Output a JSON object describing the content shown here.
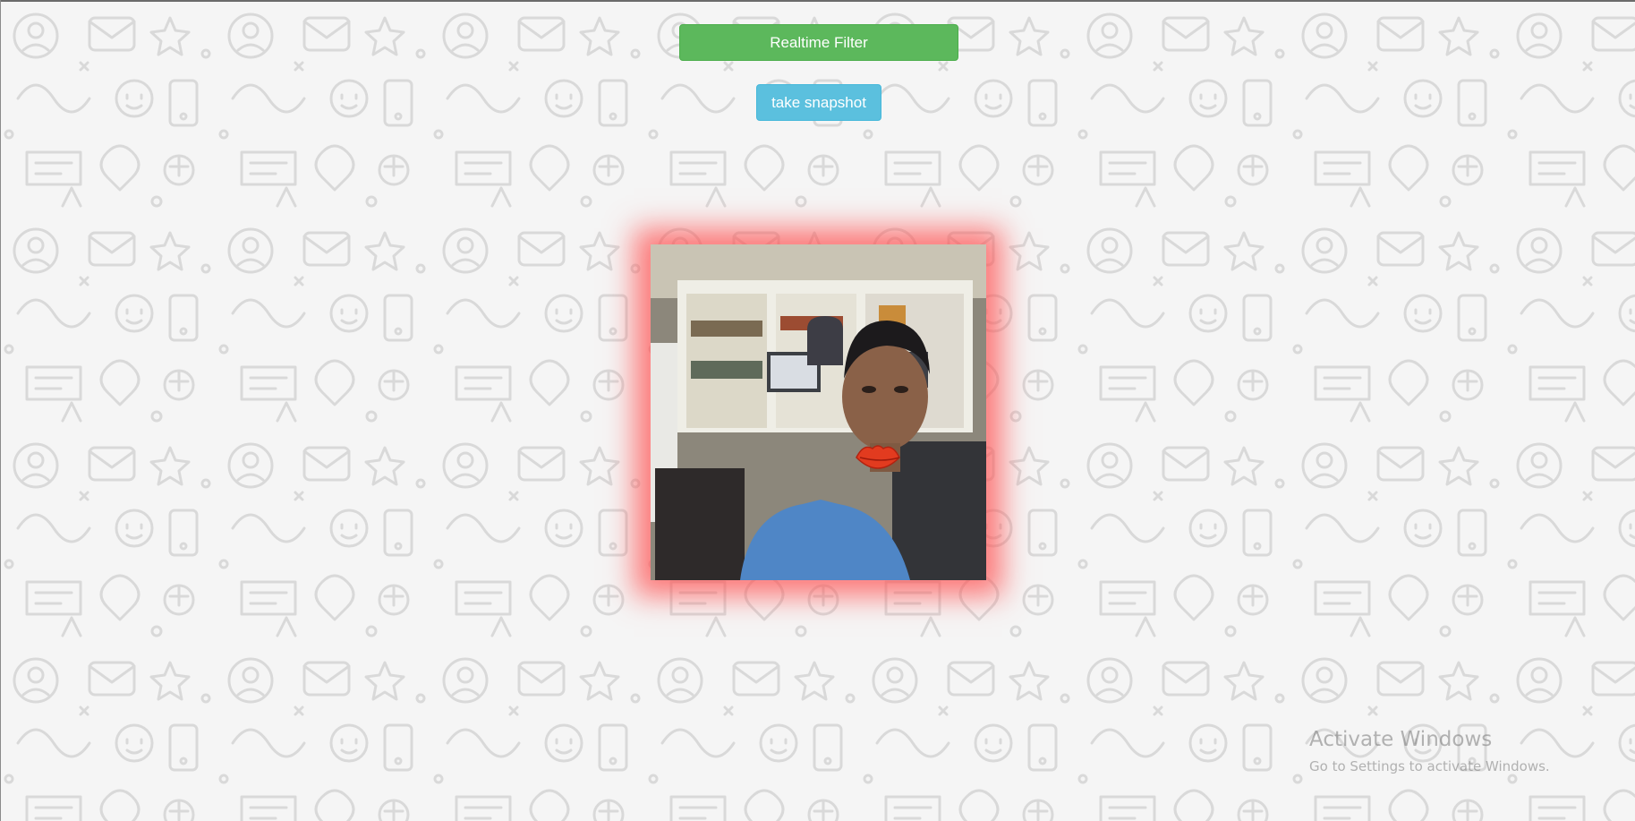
{
  "toolbar": {
    "realtime_filter_label": "Realtime Filter",
    "snapshot_label": "take snapshot"
  },
  "video": {
    "overlay_filter": "lips-icon"
  },
  "watermark": {
    "title": "Activate Windows",
    "subtitle": "Go to Settings to activate Windows."
  },
  "colors": {
    "filter_button": "#5cb85c",
    "snapshot_button": "#5bc0de",
    "video_glow": "#ff5050",
    "doodle_stroke": "#dcdcdc"
  }
}
